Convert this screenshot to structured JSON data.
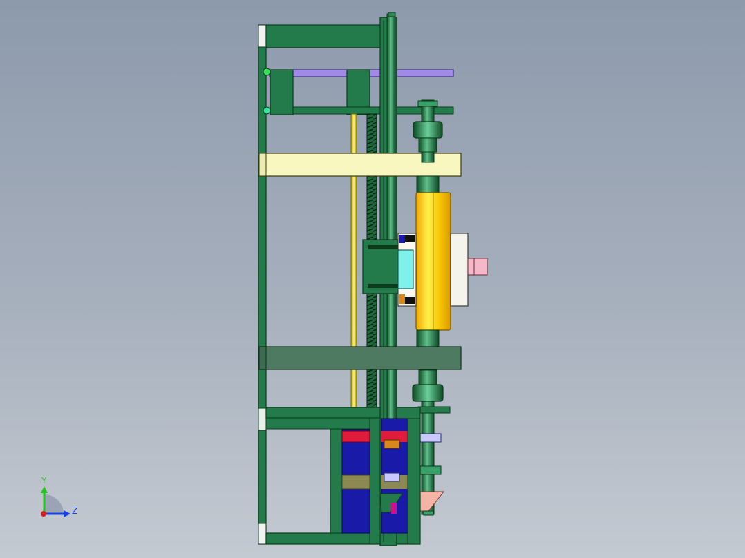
{
  "viewport": {
    "background_top": "#8d9aac",
    "background_bottom": "#c4cad2"
  },
  "colors": {
    "frame_green": "#237a4a",
    "frame_edge": "#0d3a1c",
    "dark_plate": "#4f7a62",
    "cream_plate": "#f8f7c0",
    "purple_bar": "#a18ae6",
    "yellow_roller": "#f6c400",
    "yellow_rod": "#e8d84a",
    "cyan_block": "#7ff0ea",
    "blue_block": "#1a1aa8",
    "red_band": "#e01c3c",
    "olive_band": "#8c8a52",
    "pink_shaft": "#f4b8c8",
    "salmon_wedge": "#f5b4a6",
    "orange_gear": "#d9891c",
    "lilac_collar": "#c8c8ff"
  },
  "triad": {
    "y_label": "Y",
    "z_label": "Z",
    "y_color": "#22c422",
    "z_color": "#1a44d8",
    "origin_color": "#d82020"
  }
}
